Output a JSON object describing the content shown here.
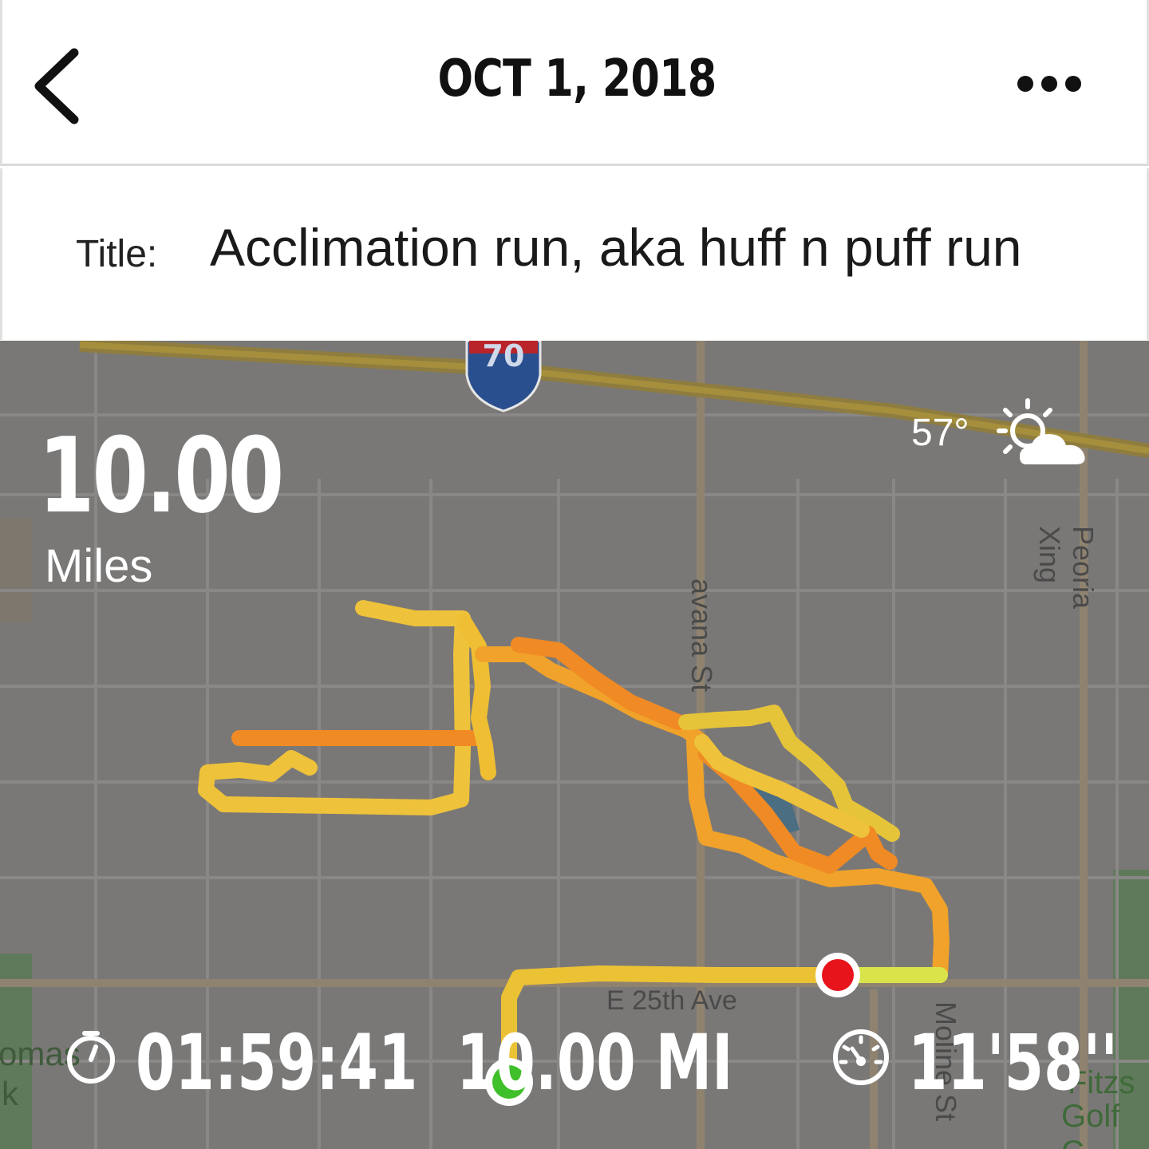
{
  "header": {
    "back_icon": "chevron-left-icon",
    "date": "OCT 1, 2018",
    "more_icon": "more-horizontal-icon"
  },
  "activity": {
    "title_label": "Title:",
    "title_value": "Acclimation run, aka huff n puff run"
  },
  "summary": {
    "distance_value": "10.00",
    "distance_unit": "Miles",
    "temperature": "57°",
    "weather_icon": "partly-sunny-icon"
  },
  "stats": {
    "duration_icon": "stopwatch-icon",
    "duration": "01:59:41",
    "distance": "10.00 MI",
    "pace_icon": "speedometer-icon",
    "pace": "11'58''"
  },
  "map": {
    "highway_shield": "70",
    "streets": {
      "havana": "avana St",
      "peoria": "Peoria Xing",
      "e25th": "E 25th Ave",
      "moline": "Moline St",
      "thomas_park_1": "omas",
      "thomas_park_2": "k",
      "fitzsimons_1": "Fitzs",
      "fitzsimons_2": "Golf C"
    },
    "start_marker_color": "#3fbf2a",
    "end_marker_color": "#e8141b",
    "route_colors": [
      "#f7e03a",
      "#f0b423",
      "#f07d1e"
    ]
  }
}
